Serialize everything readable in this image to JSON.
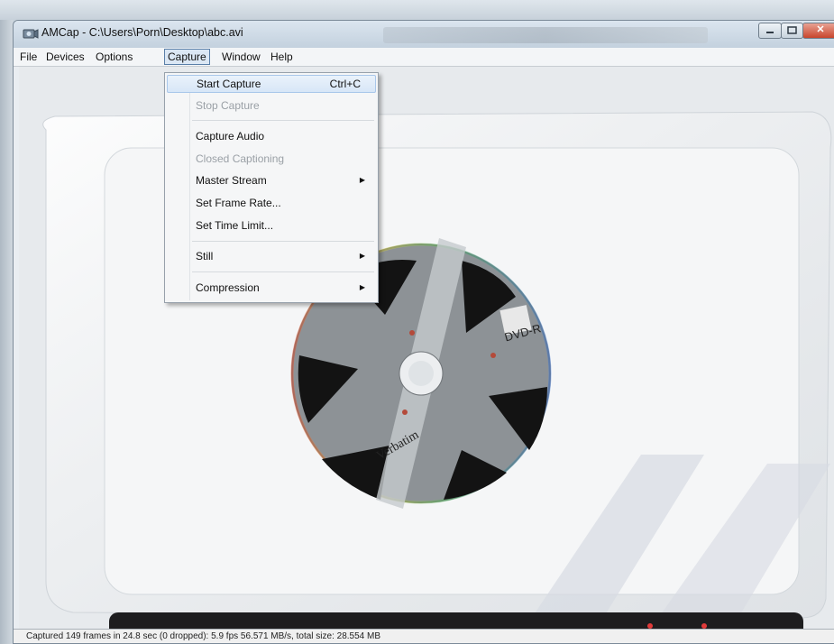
{
  "window": {
    "title": "AMCap - C:\\Users\\Porn\\Desktop\\abc.avi",
    "minimize_icon": "minimize-icon",
    "maximize_icon": "maximize-icon",
    "close_icon": "close-icon",
    "close_glyph": "✕"
  },
  "menubar": {
    "items": [
      {
        "label": "File"
      },
      {
        "label": "Devices"
      },
      {
        "label": "Options"
      },
      {
        "label": "Capture"
      },
      {
        "label": "Window"
      },
      {
        "label": "Help"
      }
    ],
    "active": "Capture"
  },
  "capture_menu": {
    "items": [
      {
        "label": "Start Capture",
        "shortcut": "Ctrl+C",
        "state": "highlighted"
      },
      {
        "label": "Stop Capture",
        "state": "disabled"
      },
      {
        "label": "Capture Audio",
        "state": "enabled"
      },
      {
        "label": "Closed Captioning",
        "state": "disabled"
      },
      {
        "label": "Master Stream",
        "submenu": true,
        "state": "enabled"
      },
      {
        "label": "Set Frame Rate...",
        "state": "enabled"
      },
      {
        "label": "Set Time Limit...",
        "state": "enabled"
      },
      {
        "label": "Still",
        "submenu": true,
        "state": "enabled"
      },
      {
        "label": "Compression",
        "submenu": true,
        "state": "enabled"
      }
    ],
    "submenu_arrow": "▶"
  },
  "video": {
    "disc_brand": "Verbatim",
    "disc_format": "DVD-R"
  },
  "statusbar": {
    "text": "Captured 149 frames in 24.8 sec (0 dropped): 5.9 fps 56.571 MB/s, total size: 28.554 MB"
  },
  "colors": {
    "highlight": "#d7e6f7",
    "close_button": "#c8452c",
    "disc": "#8d9296"
  }
}
